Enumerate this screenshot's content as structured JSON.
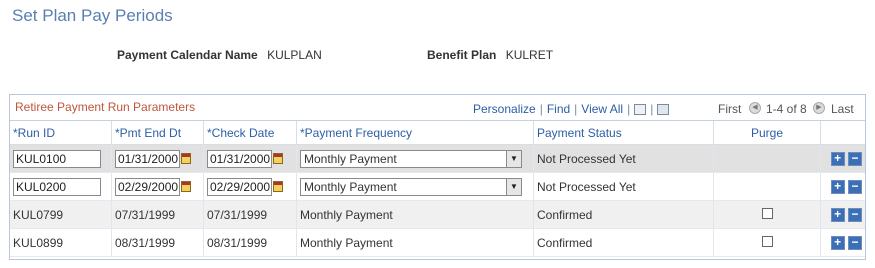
{
  "page": {
    "title": "Set Plan Pay Periods"
  },
  "header": {
    "calendar_label": "Payment Calendar Name",
    "calendar_value": "KULPLAN",
    "plan_label": "Benefit Plan",
    "plan_value": "KULRET"
  },
  "grid": {
    "title": "Retiree Payment Run Parameters",
    "personalize": "Personalize",
    "find": "Find",
    "view_all": "View All",
    "first": "First",
    "range": "1-4 of 8",
    "last": "Last",
    "columns": [
      "*Run ID",
      "*Pmt End Dt",
      "*Check Date",
      "*Payment Frequency",
      "Payment Status",
      "Purge"
    ],
    "rows": [
      {
        "run_id": "KUL0100",
        "pmt_end": "01/31/2000",
        "check": "01/31/2000",
        "freq": "Monthly Payment",
        "status": "Not Processed Yet",
        "editable": true
      },
      {
        "run_id": "KUL0200",
        "pmt_end": "02/29/2000",
        "check": "02/29/2000",
        "freq": "Monthly Payment",
        "status": "Not Processed Yet",
        "editable": true
      },
      {
        "run_id": "KUL0799",
        "pmt_end": "07/31/1999",
        "check": "07/31/1999",
        "freq": "Monthly Payment",
        "status": "Confirmed",
        "editable": false
      },
      {
        "run_id": "KUL0899",
        "pmt_end": "08/31/1999",
        "check": "08/31/1999",
        "freq": "Monthly Payment",
        "status": "Confirmed",
        "editable": false
      }
    ],
    "add_symbol": "+",
    "remove_symbol": "−"
  },
  "colors": {
    "title": "#5a7fb0",
    "grid_title": "#c0563b",
    "link": "#2b5fa6"
  }
}
